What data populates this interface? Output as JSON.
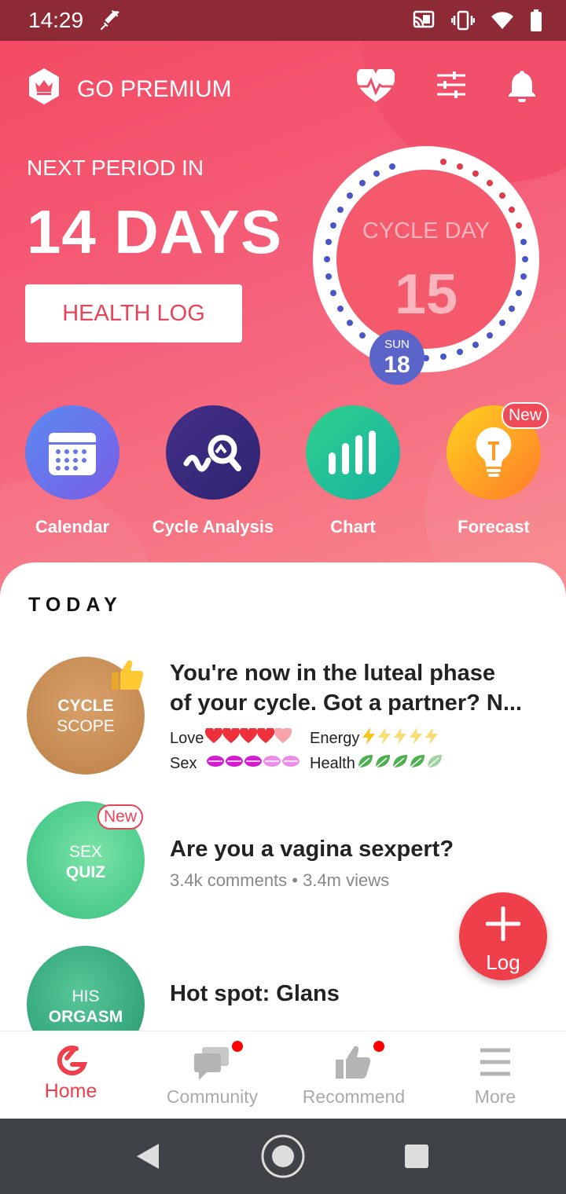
{
  "status_bar": {
    "time": "14:29",
    "icons": [
      "syringe-icon",
      "cast-icon",
      "vibrate-icon",
      "wifi-icon",
      "battery-icon"
    ]
  },
  "header": {
    "premium_label": "GO PREMIUM",
    "icons": [
      "crown-icon",
      "heart-pulse-icon",
      "sliders-icon",
      "bell-icon"
    ]
  },
  "cycle": {
    "next_period_label": "NEXT PERIOD IN",
    "days_value": "14 DAYS",
    "health_log_label": "HEALTH LOG",
    "cycle_day_label": "CYCLE DAY",
    "cycle_day_number": "15",
    "date_weekday": "SUN",
    "date_day": "18"
  },
  "features": [
    {
      "label": "Calendar",
      "icon": "calendar-icon"
    },
    {
      "label": "Cycle Analysis",
      "icon": "cycle-analysis-icon"
    },
    {
      "label": "Chart",
      "icon": "bar-chart-icon"
    },
    {
      "label": "Forecast",
      "icon": "lightbulb-icon",
      "badge": "New"
    }
  ],
  "today": {
    "heading": "TODAY",
    "items": [
      {
        "thumb_text": [
          "CYCLE",
          "SCOPE"
        ],
        "title_line1": "You're now in the luteal phase",
        "title_line2": "of your cycle. Got a partner? N...",
        "ratings": {
          "love_label": "Love",
          "energy_label": "Energy",
          "sex_label": "Sex",
          "health_label": "Health",
          "love": 4,
          "energy": 1,
          "sex": 3,
          "health": 4
        }
      },
      {
        "thumb_text": [
          "SEX",
          "QUIZ"
        ],
        "badge": "New",
        "title": "Are you a vagina sexpert?",
        "meta": "3.4k comments • 3.4m views"
      },
      {
        "thumb_text": [
          "HIS",
          "ORGASM"
        ],
        "title": "Hot spot: Glans"
      }
    ]
  },
  "fab": {
    "label": "Log"
  },
  "bottom_nav": [
    {
      "label": "Home",
      "active": true
    },
    {
      "label": "Community",
      "dot": true
    },
    {
      "label": "Recommend",
      "dot": true
    },
    {
      "label": "More"
    }
  ],
  "colors": {
    "accent": "#ef4a57",
    "hero": "#f4596c",
    "blue_dot": "#4a56c8",
    "red_dot": "#e23a4a"
  }
}
